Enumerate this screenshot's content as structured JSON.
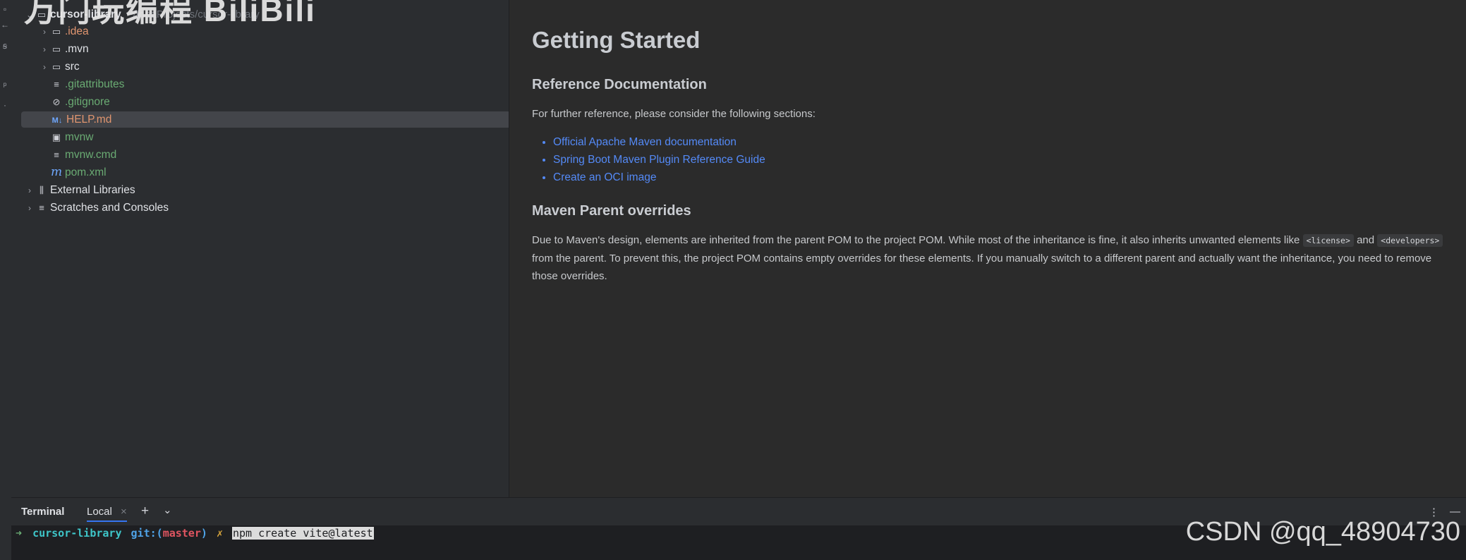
{
  "watermark": "万门玩编程 BiliBili",
  "project_tree": [
    {
      "level": 0,
      "chevron": "⌄",
      "icon": "module-folder-icon",
      "glyph": "▭",
      "label": "cursor-library",
      "style": "bold",
      "path": "~/IdeaProjects/cursor-library"
    },
    {
      "level": 1,
      "chevron": "›",
      "icon": "folder-icon",
      "glyph": "▭",
      "label": ".idea",
      "style": "orange"
    },
    {
      "level": 1,
      "chevron": "›",
      "icon": "folder-icon",
      "glyph": "▭",
      "label": ".mvn",
      "style": "white"
    },
    {
      "level": 1,
      "chevron": "›",
      "icon": "folder-icon",
      "glyph": "▭",
      "label": "src",
      "style": "white"
    },
    {
      "level": 1,
      "chevron": "",
      "icon": "text-file-icon",
      "glyph": "≡",
      "label": ".gitattributes",
      "style": "green"
    },
    {
      "level": 1,
      "chevron": "",
      "icon": "ignore-file-icon",
      "glyph": "⊘",
      "label": ".gitignore",
      "style": "green"
    },
    {
      "level": 1,
      "chevron": "",
      "icon": "markdown-file-icon",
      "glyph": "M↓",
      "label": "HELP.md",
      "style": "orange",
      "selected": true
    },
    {
      "level": 1,
      "chevron": "",
      "icon": "shell-script-icon",
      "glyph": "▣",
      "label": "mvnw",
      "style": "green"
    },
    {
      "level": 1,
      "chevron": "",
      "icon": "text-file-icon",
      "glyph": "≡",
      "label": "mvnw.cmd",
      "style": "green"
    },
    {
      "level": 1,
      "chevron": "",
      "icon": "maven-file-icon",
      "glyph": "m",
      "label": "pom.xml",
      "style": "green"
    },
    {
      "level": 0,
      "chevron": "›",
      "icon": "libraries-icon",
      "glyph": "⫼",
      "label": "External Libraries",
      "style": "white"
    },
    {
      "level": 0,
      "chevron": "›",
      "icon": "scratches-icon",
      "glyph": "≡",
      "label": "Scratches and Consoles",
      "style": "white"
    }
  ],
  "doc": {
    "title": "Getting Started",
    "ref_heading": "Reference Documentation",
    "ref_intro": "For further reference, please consider the following sections:",
    "links": [
      "Official Apache Maven documentation",
      "Spring Boot Maven Plugin Reference Guide",
      "Create an OCI image"
    ],
    "maven_heading": "Maven Parent overrides",
    "maven_p1": "Due to Maven's design, elements are inherited from the parent POM to the project POM. While most of the inheritance is fine, it also inherits unwanted elements like",
    "code_license": "<license>",
    "and": "and",
    "code_developers": "<developers>",
    "maven_p2": "from the parent. To prevent this, the project POM contains empty overrides for these elements. If you manually switch to a different parent and actually want the inheritance, you need to remove those overrides."
  },
  "terminal": {
    "title": "Terminal",
    "tab": "Local",
    "close": "×",
    "add": "+",
    "dropdown": "⌄",
    "menu": "⋮",
    "minimize": "—",
    "prompt_arrow": "➜",
    "prompt_dir": "cursor-library",
    "prompt_git": "git:(",
    "prompt_branch": "master",
    "prompt_git_end": ")",
    "prompt_dirty": "✗",
    "command": "npm create vite@latest"
  },
  "csdn_watermark": "CSDN @qq_48904730"
}
